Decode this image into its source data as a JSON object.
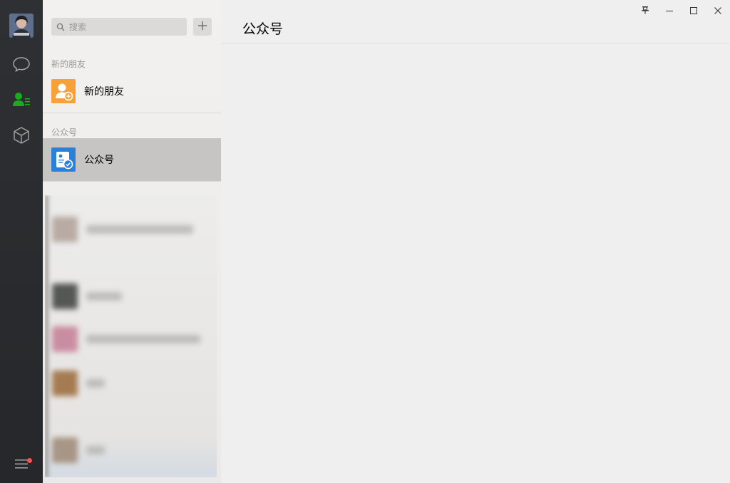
{
  "window": {
    "controls": [
      "pin",
      "minimize",
      "maximize",
      "close"
    ]
  },
  "rail": {
    "avatar": "user-avatar",
    "items": [
      {
        "id": "chat",
        "icon": "chat-bubble-icon",
        "active": false
      },
      {
        "id": "contacts",
        "icon": "contacts-icon",
        "active": true
      },
      {
        "id": "favorites",
        "icon": "cube-icon",
        "active": false
      }
    ],
    "menu": {
      "icon": "menu-icon",
      "badge": true
    },
    "colors": {
      "active": "#1aad19",
      "inactive": "#a3a5a8",
      "badge": "#fa5151"
    }
  },
  "search": {
    "placeholder": "搜索",
    "add_icon": "plus-icon"
  },
  "sections": [
    {
      "header": "新的朋友",
      "items": [
        {
          "label": "新的朋友",
          "icon": "add-friend-icon",
          "color": "#f6a13a"
        }
      ]
    },
    {
      "header": "公众号",
      "items": [
        {
          "label": "公众号",
          "icon": "official-account-icon",
          "color": "#2b81d7",
          "selected": true
        }
      ]
    }
  ],
  "main": {
    "title": "公众号"
  }
}
